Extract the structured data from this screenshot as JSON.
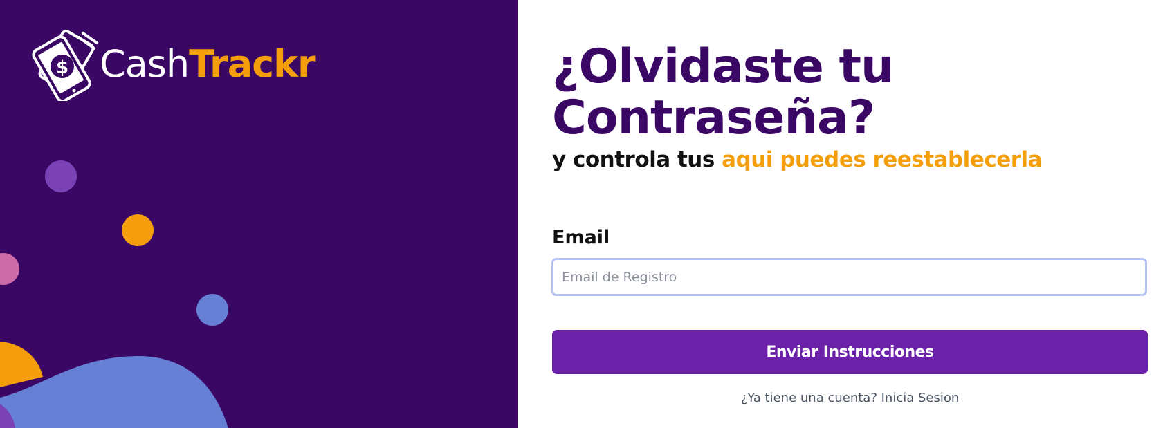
{
  "brand": {
    "name_part1": "Cash",
    "name_part2": "Trackr",
    "icon": "cash-phone-logo-icon",
    "colors": {
      "primary": "#3b0764",
      "accent": "#f59e0b",
      "button": "#6b21a8"
    }
  },
  "page": {
    "title": "¿Olvidaste tu Contraseña?",
    "subtitle_prefix": "y controla tus ",
    "subtitle_accent": "aqui puedes reestablecerla"
  },
  "form": {
    "email_label": "Email",
    "email_placeholder": "Email de Registro",
    "email_value": "",
    "submit_label": "Enviar Instrucciones",
    "login_link": "¿Ya tiene una cuenta? Inicia Sesion"
  }
}
